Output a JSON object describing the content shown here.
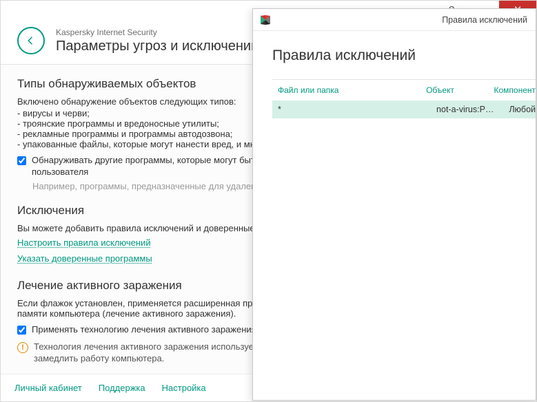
{
  "titlebar": {
    "help": "?",
    "min": "—",
    "close": "✕"
  },
  "product": "Kaspersky Internet Security",
  "page_title": "Параметры угроз и исключений",
  "sections": {
    "types": {
      "heading": "Типы обнаруживаемых объектов",
      "intro": "Включено обнаружение объектов следующих типов:",
      "items": [
        "- вирусы и черви;",
        "- троянские программы и вредоносные утилиты;",
        "- рекламные программы и программы автодозвона;",
        "- упакованные файлы, которые могут нанести вред, и многократно упакованные файлы."
      ],
      "detect_other_label": "Обнаруживать другие программы, которые могут быть использованы для угроз компьютеру или данным пользователя",
      "detect_other_hint": "Например, программы, предназначенные для удаленного администрирования."
    },
    "exclusions": {
      "heading": "Исключения",
      "desc": "Вы можете добавить правила исключений и доверенные программы.",
      "link_rules": "Настроить правила исключений",
      "link_trusted": "Указать доверенные программы"
    },
    "active": {
      "heading": "Лечение активного заражения",
      "desc": "Если флажок установлен, применяется расширенная процедура лечения: завершаются все процессы в оперативной памяти компьютера (лечение активного заражения).",
      "apply_label": "Применять технологию лечения активного заражения",
      "warning": "Технология лечения активного заражения использует значительные ресурсы. Лечение активного заражения может замедлить работу компьютера."
    }
  },
  "footer": {
    "cabinet": "Личный кабинет",
    "support": "Поддержка",
    "settings": "Настройка"
  },
  "overlay": {
    "title_small": "Правила исключений",
    "heading": "Правила исключений",
    "columns": {
      "file": "Файл или папка",
      "object": "Объект",
      "comp": "Компонент"
    },
    "row": {
      "file": "*",
      "object": "not-a-virus:P…",
      "comp": "Любой"
    }
  }
}
